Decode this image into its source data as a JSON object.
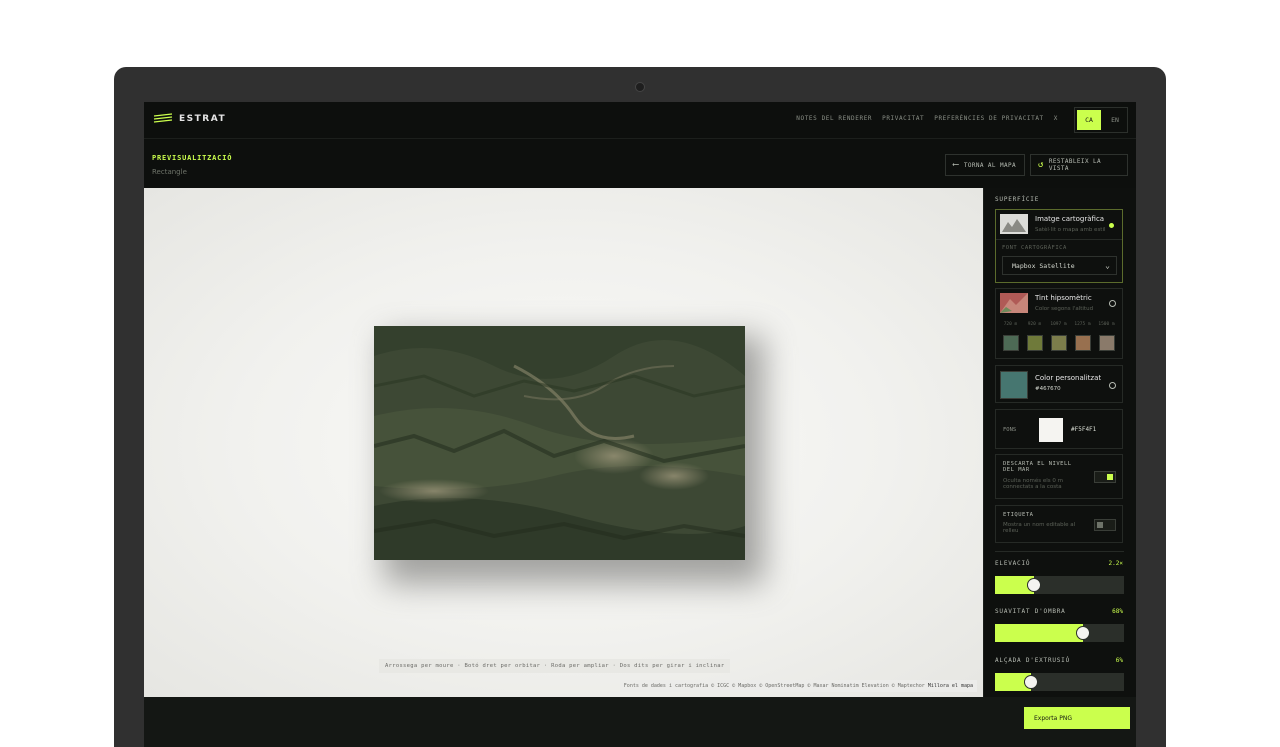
{
  "app": {
    "name": "ESTRAT"
  },
  "nav": {
    "links": [
      "NOTES DEL RENDERER",
      "PRIVACITAT",
      "PREFERÈNCIES DE PRIVACITAT",
      "X"
    ],
    "languages": [
      "CA",
      "EN"
    ],
    "active_language": "CA"
  },
  "header": {
    "title": "PREVISUALITZACIÓ",
    "subtitle": "Rectangle",
    "back_button": "TORNA AL MAPA",
    "reset_button": "RESTABLEIX LA VISTA"
  },
  "sidebar": {
    "surface_title": "SUPERFÍCIE",
    "surface_options": [
      {
        "title": "Imatge cartogràfica",
        "desc": "Satèl·lit o mapa amb estil",
        "selected": true
      },
      {
        "title": "Tint hipsomètric",
        "desc": "Color segons l'altitud",
        "selected": false
      },
      {
        "title": "Color personalitzat",
        "desc": "#467670",
        "selected": false
      }
    ],
    "source_label": "FONT CARTOGRÀFICA",
    "source_value": "Mapbox Satellite",
    "tint_stops": [
      "720 m",
      "920 m",
      "1097 m",
      "1275 m",
      "1500 m"
    ],
    "tint_colors": [
      "#4d6a55",
      "#6f7a3a",
      "#7c7d4b",
      "#98704f",
      "#8a7a6a"
    ],
    "custom_color": "#467670",
    "background_label": "FONS",
    "background_value": "#F5F4F1",
    "sea_level": {
      "title": "DESCARTA EL NIVELL DEL MAR",
      "desc": "Oculta només els 0 m connectats a la costa",
      "enabled": true
    },
    "label": {
      "title": "ETIQUETA",
      "desc": "Mostra un nom editable al relleu",
      "enabled": false
    },
    "elevation": {
      "label": "ELEVACIÓ",
      "value": "2.2×",
      "fraction": 0.3
    },
    "shadow_softness": {
      "label": "SUAVITAT D'OMBRA",
      "value": "68%",
      "fraction": 0.68
    },
    "extrusion_height": {
      "label": "ALÇADA D'EXTRUSIÓ",
      "value": "6%",
      "fraction": 0.28
    }
  },
  "preview": {
    "hint": "Arrossega per moure · Botó dret per orbitar · Roda per ampliar · Dos dits per girar i inclinar",
    "credits": "Fonts de dades i cartografia © ICGC © Mapbox © OpenStreetMap © Maxar Nominatim Elevation © Maptechor",
    "improve_link": "Millora el mapa"
  },
  "footer": {
    "export_label": "Exporta PNG"
  },
  "colors": {
    "accent": "#cbff4d",
    "panel": "#0e100e",
    "preview_bg": "#F5F4F1"
  }
}
